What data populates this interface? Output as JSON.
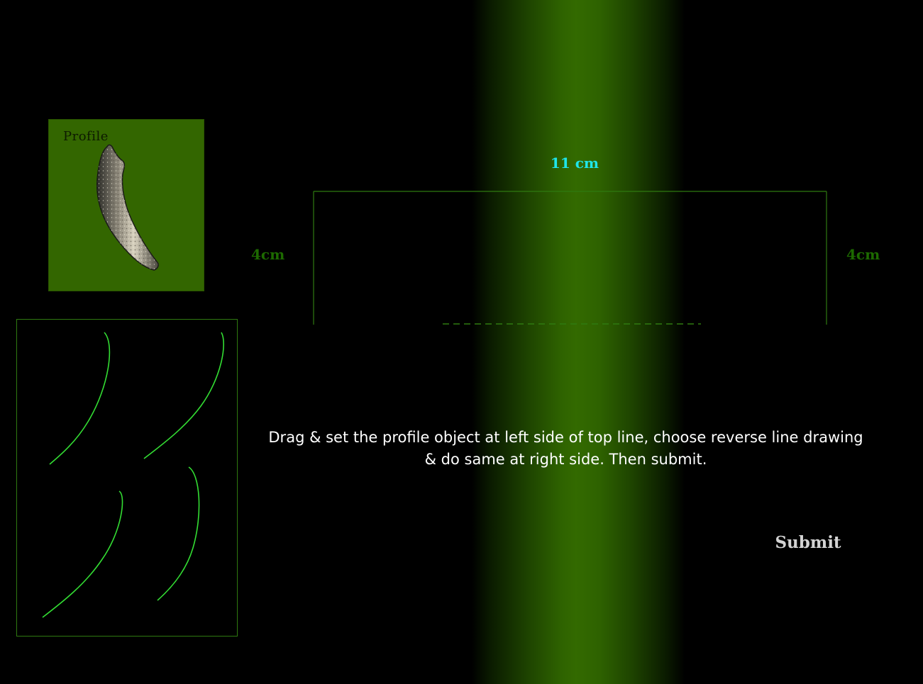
{
  "profile_card": {
    "label": "Profile",
    "bg_color": "#336600",
    "object_icon": "horn-profile-object"
  },
  "line_options": {
    "stroke_color": "#33dd33",
    "items": [
      "curve-option-1",
      "curve-option-2",
      "curve-option-3",
      "curve-option-4"
    ]
  },
  "dimensions": {
    "top": "11 cm",
    "left": "4cm",
    "right": "4cm",
    "top_color": "#1fe5ea",
    "side_color": "#1d6a00"
  },
  "instructions": {
    "line1": "Drag & set the profile object at left side of top line, choose reverse line drawing",
    "line2": "& do same at right side. Then submit."
  },
  "submit": {
    "label": "Submit"
  }
}
